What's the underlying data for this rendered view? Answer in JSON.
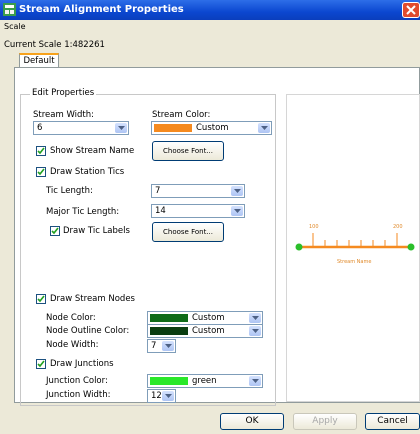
{
  "window": {
    "title": "Stream Alignment Properties"
  },
  "menu": {
    "scale": "Scale"
  },
  "current_scale": "Current Scale 1:482261",
  "tabs": {
    "default": "Default"
  },
  "edit_properties": {
    "title": "Edit Properties",
    "stream_width_label": "Stream Width:",
    "stream_width_value": "6",
    "stream_color_label": "Stream Color:",
    "stream_color_value": "Custom",
    "stream_color_hex": "#f58a1f",
    "show_stream_name_label": "Show Stream Name",
    "show_stream_name_checked": true,
    "choose_font_label": "Choose Font...",
    "draw_station_tics_label": "Draw Station Tics",
    "draw_station_tics_checked": true,
    "tic_length_label": "Tic Length:",
    "tic_length_value": "7",
    "major_tic_length_label": "Major Tic Length:",
    "major_tic_length_value": "14",
    "draw_tic_labels_label": "Draw Tic Labels",
    "draw_tic_labels_checked": true,
    "choose_font_label_2": "Choose Font...",
    "draw_stream_nodes_label": "Draw Stream Nodes",
    "draw_stream_nodes_checked": true,
    "node_color_label": "Node Color:",
    "node_color_value": "Custom",
    "node_color_hex": "#0e6b18",
    "node_outline_color_label": "Node Outline Color:",
    "node_outline_color_value": "Custom",
    "node_outline_color_hex": "#0a3d10",
    "node_width_label": "Node Width:",
    "node_width_value": "7",
    "draw_junctions_label": "Draw Junctions",
    "draw_junctions_checked": true,
    "junction_color_label": "Junction Color:",
    "junction_color_value": "green",
    "junction_color_hex": "#29e829",
    "junction_width_label": "Junction Width:",
    "junction_width_value": "12"
  },
  "preview": {
    "stream_name": "Stream Name",
    "tic_label_left": "100",
    "tic_label_right": "200",
    "line_color": "#f58a1f",
    "node_color": "#2bbf2b"
  },
  "buttons": {
    "ok": "OK",
    "apply": "Apply",
    "cancel": "Cancel"
  }
}
